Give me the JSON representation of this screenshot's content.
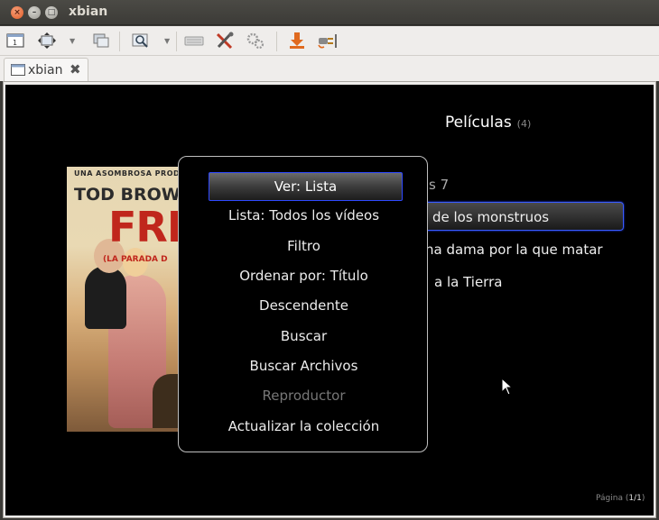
{
  "window": {
    "title": "xbian",
    "close_glyph": "×",
    "min_glyph": "–",
    "max_glyph": "□"
  },
  "toolbar": {
    "icons": [
      "console-icon",
      "fullscreen-icon",
      "windows-icon",
      "zoom-icon",
      "keyboard-icon",
      "tools-icon",
      "settings-icon",
      "download-icon",
      "plug-icon"
    ]
  },
  "tab": {
    "label": "xbian",
    "close_glyph": "✖"
  },
  "kodi": {
    "heading": "Películas",
    "count": "(4)",
    "list": [
      {
        "label": "s 7"
      },
      {
        "label": "de los monstruos"
      },
      {
        "label": "na dama por la que matar"
      },
      {
        "label": "a la Tierra"
      }
    ],
    "poster": {
      "line1": "UNA ASOMBROSA PRODUC",
      "line2": "TOD BROWN",
      "line3": "FRE",
      "line4": "(LA PARADA D"
    },
    "page_prefix": "Página (",
    "page_value": "1/1",
    "page_suffix": ")"
  },
  "context_menu": {
    "items": [
      {
        "label": "Ver: Lista",
        "state": "focused"
      },
      {
        "label": "Lista: Todos los vídeos",
        "state": "normal"
      },
      {
        "label": "Filtro",
        "state": "normal"
      },
      {
        "label": "Ordenar por: Título",
        "state": "normal"
      },
      {
        "label": "Descendente",
        "state": "normal"
      },
      {
        "label": "Buscar",
        "state": "normal"
      },
      {
        "label": "Buscar Archivos",
        "state": "normal"
      },
      {
        "label": "Reproductor",
        "state": "disabled"
      },
      {
        "label": "Actualizar la colección",
        "state": "normal"
      }
    ]
  },
  "colors": {
    "focus_border": "#2f49ff",
    "title_text": "#dfdbd2",
    "close_button": "#e05a25"
  }
}
